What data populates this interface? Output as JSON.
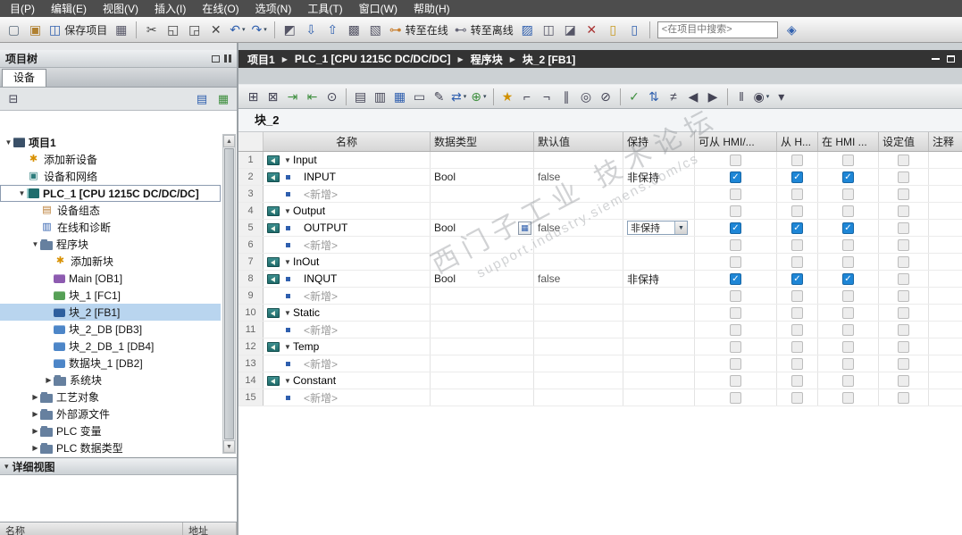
{
  "menu": {
    "items": [
      "目(P)",
      "编辑(E)",
      "视图(V)",
      "插入(I)",
      "在线(O)",
      "选项(N)",
      "工具(T)",
      "窗口(W)",
      "帮助(H)"
    ]
  },
  "toolbar": {
    "items": [
      {
        "type": "icon",
        "name": "new-project-icon",
        "glyph": "▢",
        "color": "#5a6b7c"
      },
      {
        "type": "icon",
        "name": "open-project-icon",
        "glyph": "▣",
        "color": "#b08030"
      },
      {
        "type": "icon-label",
        "name": "save-project-button",
        "glyph": "◫",
        "color": "#2f5fae",
        "label": "保存项目"
      },
      {
        "type": "icon",
        "name": "print-icon",
        "glyph": "▦",
        "color": "#556"
      },
      {
        "type": "sep"
      },
      {
        "type": "icon",
        "name": "cut-icon",
        "glyph": "✂",
        "color": "#444"
      },
      {
        "type": "icon",
        "name": "copy-icon",
        "glyph": "◱",
        "color": "#444"
      },
      {
        "type": "icon",
        "name": "paste-icon",
        "glyph": "◲",
        "color": "#444"
      },
      {
        "type": "icon",
        "name": "delete-icon",
        "glyph": "✕",
        "color": "#444"
      },
      {
        "type": "icon",
        "name": "undo-button",
        "glyph": "↶",
        "color": "#2f5fae",
        "dropdown": true
      },
      {
        "type": "icon",
        "name": "redo-button",
        "glyph": "↷",
        "color": "#2f5fae",
        "dropdown": true
      },
      {
        "type": "sep"
      },
      {
        "type": "icon",
        "name": "compile-icon",
        "glyph": "◩",
        "color": "#556"
      },
      {
        "type": "icon",
        "name": "download-to-device-icon",
        "glyph": "⇩",
        "color": "#2f5fae"
      },
      {
        "type": "icon",
        "name": "upload-from-device-icon",
        "glyph": "⇧",
        "color": "#2f5fae"
      },
      {
        "type": "icon",
        "name": "start-simulation-icon",
        "glyph": "▩",
        "color": "#556"
      },
      {
        "type": "icon",
        "name": "runtime-icon",
        "glyph": "▧",
        "color": "#556"
      },
      {
        "type": "icon-label",
        "name": "go-online-button",
        "glyph": "⊶",
        "color": "#c87f2f",
        "label": "转至在线"
      },
      {
        "type": "icon-label",
        "name": "go-offline-button",
        "glyph": "⊷",
        "color": "#667",
        "label": "转至离线"
      },
      {
        "type": "icon",
        "name": "online-diagnostics-icon",
        "glyph": "▨",
        "color": "#2f5fae"
      },
      {
        "type": "icon",
        "name": "cross-references-icon",
        "glyph": "◫",
        "color": "#556"
      },
      {
        "type": "icon",
        "name": "show-all-icon",
        "glyph": "◪",
        "color": "#556"
      },
      {
        "type": "icon",
        "name": "close-icon",
        "glyph": "✕",
        "color": "#a33"
      },
      {
        "type": "icon",
        "name": "split-editor-horizontal-icon",
        "glyph": "▯",
        "color": "#c89a20"
      },
      {
        "type": "icon",
        "name": "split-editor-vertical-icon",
        "glyph": "▯",
        "color": "#2f5fae"
      },
      {
        "type": "sep"
      },
      {
        "type": "search",
        "name": "project-search-input",
        "placeholder": "<在项目中搜索>"
      },
      {
        "type": "icon",
        "name": "search-button",
        "glyph": "◈",
        "color": "#2f5fae"
      }
    ]
  },
  "breadcrumb": {
    "items": [
      "项目1",
      "PLC_1 [CPU 1215C DC/DC/DC]",
      "程序块",
      "块_2 [FB1]"
    ]
  },
  "project_tree": {
    "title": "项目树",
    "tab": "设备",
    "details_title": "详细视图",
    "detail_columns": [
      "名称",
      "地址"
    ],
    "items": [
      {
        "label": "项目1",
        "icon": "project",
        "level": 0,
        "expander": "down",
        "bold": true
      },
      {
        "label": "添加新设备",
        "icon": "add-device",
        "level": 1
      },
      {
        "label": "设备和网络",
        "icon": "device-network",
        "level": 1
      },
      {
        "label": "PLC_1 [CPU 1215C DC/DC/DC]",
        "icon": "plc",
        "level": 1,
        "expander": "down",
        "focused": true,
        "bold": true
      },
      {
        "label": "设备组态",
        "icon": "device-config",
        "level": 2
      },
      {
        "label": "在线和诊断",
        "icon": "online-diag",
        "level": 2
      },
      {
        "label": "程序块",
        "icon": "folder",
        "level": 2,
        "expander": "down"
      },
      {
        "label": "添加新块",
        "icon": "add-block",
        "level": 3
      },
      {
        "label": "Main [OB1]",
        "icon": "ob-block",
        "level": 3
      },
      {
        "label": "块_1 [FC1]",
        "icon": "fc-block",
        "level": 3
      },
      {
        "label": "块_2 [FB1]",
        "icon": "fb-block",
        "level": 3,
        "selected": true
      },
      {
        "label": "块_2_DB [DB3]",
        "icon": "db-block",
        "level": 3
      },
      {
        "label": "块_2_DB_1 [DB4]",
        "icon": "db-block",
        "level": 3
      },
      {
        "label": "数据块_1 [DB2]",
        "icon": "db-block",
        "level": 3
      },
      {
        "label": "系统块",
        "icon": "folder",
        "level": 3,
        "expander": "right"
      },
      {
        "label": "工艺对象",
        "icon": "folder",
        "level": 2,
        "expander": "right"
      },
      {
        "label": "外部源文件",
        "icon": "folder",
        "level": 2,
        "expander": "right"
      },
      {
        "label": "PLC 变量",
        "icon": "folder",
        "level": 2,
        "expander": "right"
      },
      {
        "label": "PLC 数据类型",
        "icon": "folder",
        "level": 2,
        "expander": "right"
      }
    ]
  },
  "editor_toolbar": {
    "items": [
      {
        "type": "icon",
        "name": "insert-network-icon",
        "glyph": "⊞",
        "color": "#445"
      },
      {
        "type": "icon",
        "name": "delete-network-icon",
        "glyph": "⊠",
        "color": "#445"
      },
      {
        "type": "icon",
        "name": "insert-row-icon",
        "glyph": "⇥",
        "color": "#3e8f3e"
      },
      {
        "type": "icon",
        "name": "add-row-icon",
        "glyph": "⇤",
        "color": "#3e8f3e"
      },
      {
        "type": "icon",
        "name": "keep-start-values-icon",
        "glyph": "⊙",
        "color": "#445"
      },
      {
        "type": "sep"
      },
      {
        "type": "icon",
        "name": "expand-members-icon",
        "glyph": "▤",
        "color": "#445"
      },
      {
        "type": "icon",
        "name": "collapse-members-icon",
        "glyph": "▥",
        "color": "#445"
      },
      {
        "type": "icon",
        "name": "data-view-icon",
        "glyph": "▦",
        "color": "#2f5fae"
      },
      {
        "type": "icon",
        "name": "comment-toggle-icon",
        "glyph": "▭",
        "color": "#445"
      },
      {
        "type": "icon",
        "name": "edit-comment-icon",
        "glyph": "✎",
        "color": "#445"
      },
      {
        "type": "icon",
        "name": "insert-input-icon",
        "glyph": "⇄",
        "color": "#2f5fae",
        "dropdown": true
      },
      {
        "type": "icon",
        "name": "insert-element-icon",
        "glyph": "⊕",
        "color": "#3e8f3e",
        "dropdown": true
      },
      {
        "type": "sep"
      },
      {
        "type": "icon",
        "name": "favorites-icon",
        "glyph": "★",
        "color": "#d09000"
      },
      {
        "type": "icon",
        "name": "open-branch-icon",
        "glyph": "⌐",
        "color": "#445"
      },
      {
        "type": "icon",
        "name": "close-branch-icon",
        "glyph": "¬",
        "color": "#445"
      },
      {
        "type": "icon",
        "name": "parallel-branch-icon",
        "glyph": "∥",
        "color": "#445"
      },
      {
        "type": "icon",
        "name": "coil-icon",
        "glyph": "◎",
        "color": "#445"
      },
      {
        "type": "icon",
        "name": "negate-icon",
        "glyph": "⊘",
        "color": "#445"
      },
      {
        "type": "sep"
      },
      {
        "type": "icon",
        "name": "check-consistency-icon",
        "glyph": "✓",
        "color": "#3e8f3e"
      },
      {
        "type": "icon",
        "name": "compare-icon",
        "glyph": "⇅",
        "color": "#2f5fae"
      },
      {
        "type": "icon",
        "name": "crossings-icon",
        "glyph": "≠",
        "color": "#445"
      },
      {
        "type": "icon",
        "name": "jump-prev-icon",
        "glyph": "◀",
        "color": "#445"
      },
      {
        "type": "icon",
        "name": "jump-next-icon",
        "glyph": "▶",
        "color": "#445"
      },
      {
        "type": "sep"
      },
      {
        "type": "icon",
        "name": "pause-monitoring-icon",
        "glyph": "‖",
        "color": "#445"
      },
      {
        "type": "icon",
        "name": "monitor-toggle-icon",
        "glyph": "◉",
        "color": "#445",
        "dropdown": true
      },
      {
        "type": "icon",
        "name": "more-options-icon",
        "glyph": "▾",
        "color": "#445"
      }
    ]
  },
  "editor": {
    "block_title": "块_2",
    "watermark": {
      "line1": "西门子工业 技术论坛",
      "line2": "support.industry.siemens.com/cs"
    },
    "table": {
      "columns": [
        "名称",
        "数据类型",
        "默认值",
        "保持",
        "可从 HMI/...",
        "从 H...",
        "在 HMI ...",
        "设定值",
        "注释"
      ],
      "rows": [
        {
          "num": "1",
          "kind": "section",
          "name": "Input"
        },
        {
          "num": "2",
          "kind": "var",
          "name": "INPUT",
          "type": "Bool",
          "default": "false",
          "retain": "非保持",
          "hmi": [
            true,
            true,
            true
          ],
          "setpoint": false
        },
        {
          "num": "3",
          "kind": "add",
          "name": "<新增>"
        },
        {
          "num": "4",
          "kind": "section",
          "name": "Output"
        },
        {
          "num": "5",
          "kind": "var",
          "name": "OUTPUT",
          "type": "Bool",
          "default": "false",
          "retain": "非保持",
          "hmi": [
            true,
            true,
            true
          ],
          "setpoint": false,
          "type_picker": true,
          "retain_dropdown": true
        },
        {
          "num": "6",
          "kind": "add",
          "name": "<新增>"
        },
        {
          "num": "7",
          "kind": "section",
          "name": "InOut"
        },
        {
          "num": "8",
          "kind": "var",
          "name": "INQUT",
          "type": "Bool",
          "default": "false",
          "retain": "非保持",
          "hmi": [
            true,
            true,
            true
          ],
          "setpoint": false
        },
        {
          "num": "9",
          "kind": "add",
          "name": "<新增>"
        },
        {
          "num": "10",
          "kind": "section",
          "name": "Static"
        },
        {
          "num": "11",
          "kind": "add",
          "name": "<新增>"
        },
        {
          "num": "12",
          "kind": "section",
          "name": "Temp"
        },
        {
          "num": "13",
          "kind": "add",
          "name": "<新增>"
        },
        {
          "num": "14",
          "kind": "section",
          "name": "Constant"
        },
        {
          "num": "15",
          "kind": "add",
          "name": "<新增>"
        }
      ]
    }
  }
}
